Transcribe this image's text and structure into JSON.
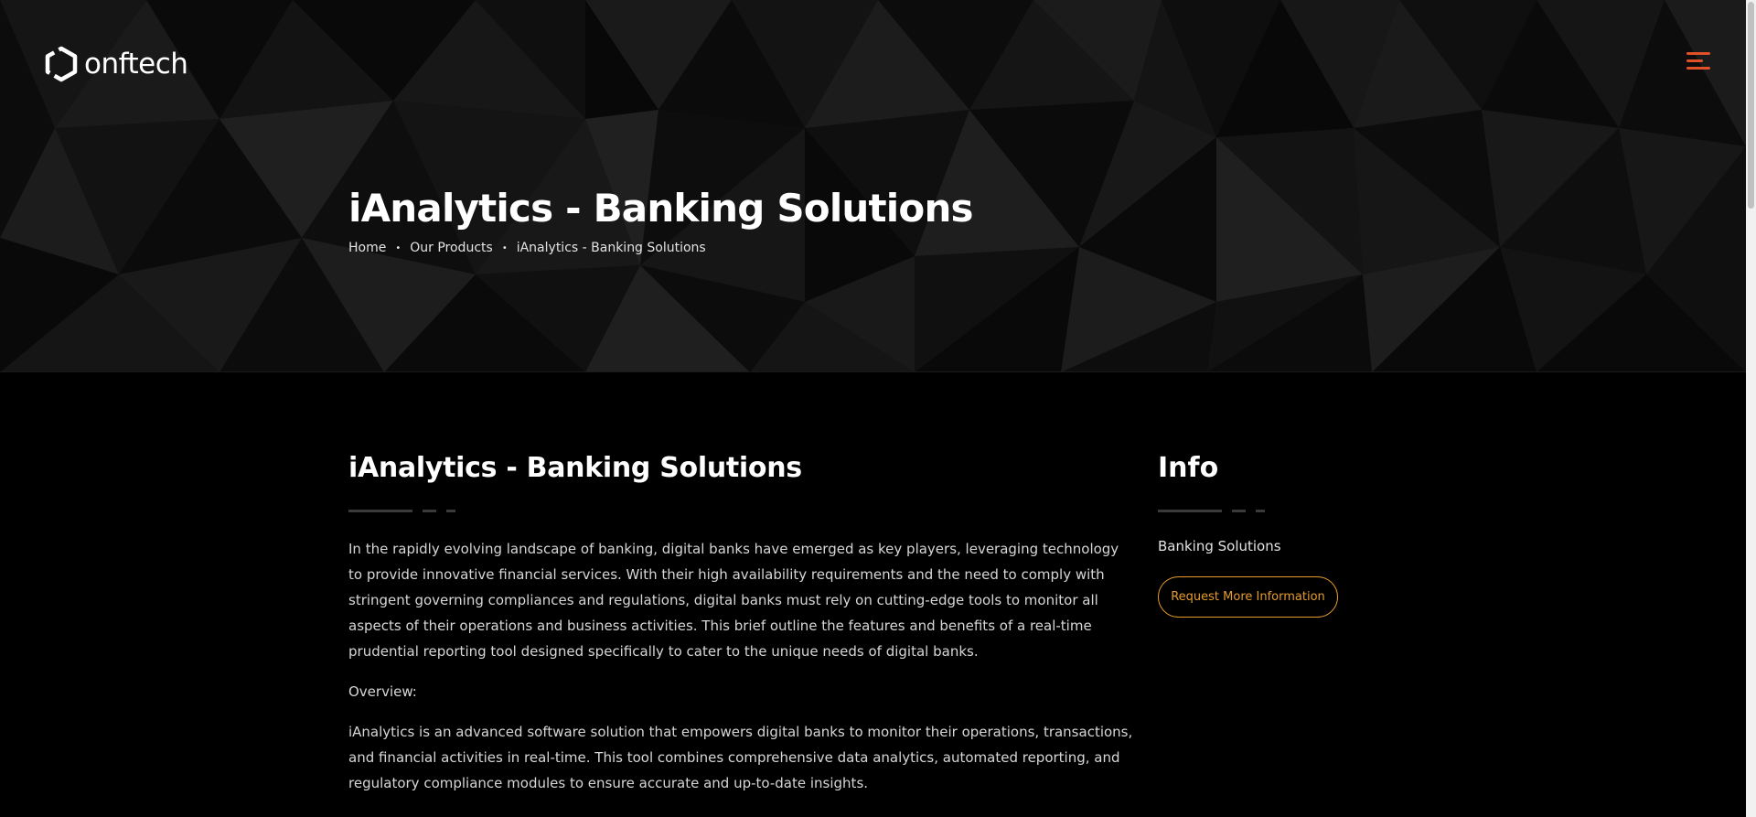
{
  "brand": {
    "name": "onftech"
  },
  "header": {
    "menu_icon": "hamburger-menu-icon"
  },
  "hero": {
    "title": "iAnalytics - Banking Solutions",
    "breadcrumb": [
      "Home",
      "Our Products",
      "iAnalytics - Banking Solutions"
    ],
    "breadcrumb_separator": "•"
  },
  "main": {
    "title": "iAnalytics - Banking Solutions",
    "paragraphs": [
      "In the rapidly evolving landscape of banking, digital banks have emerged as key players, leveraging technology to provide innovative financial services. With their high availability requirements and the need to comply with stringent governing compliances and regulations, digital banks must rely on cutting-edge tools to monitor all aspects of their operations and business activities. This brief outline the features and benefits of a real-time prudential reporting tool designed specifically to cater to the unique needs of digital banks.",
      "Overview:",
      "iAnalytics is an advanced software solution that empowers digital banks to monitor their operations, transactions, and financial activities in real-time. This tool combines comprehensive data analytics, automated reporting, and regulatory compliance modules to ensure accurate and up-to-date insights."
    ]
  },
  "sidebar": {
    "title": "Info",
    "category": "Banking Solutions",
    "button_label": "Request More Information"
  },
  "colors": {
    "accent_orange": "#e59b2a",
    "menu_orange": "#e0512a",
    "background": "#000000"
  }
}
